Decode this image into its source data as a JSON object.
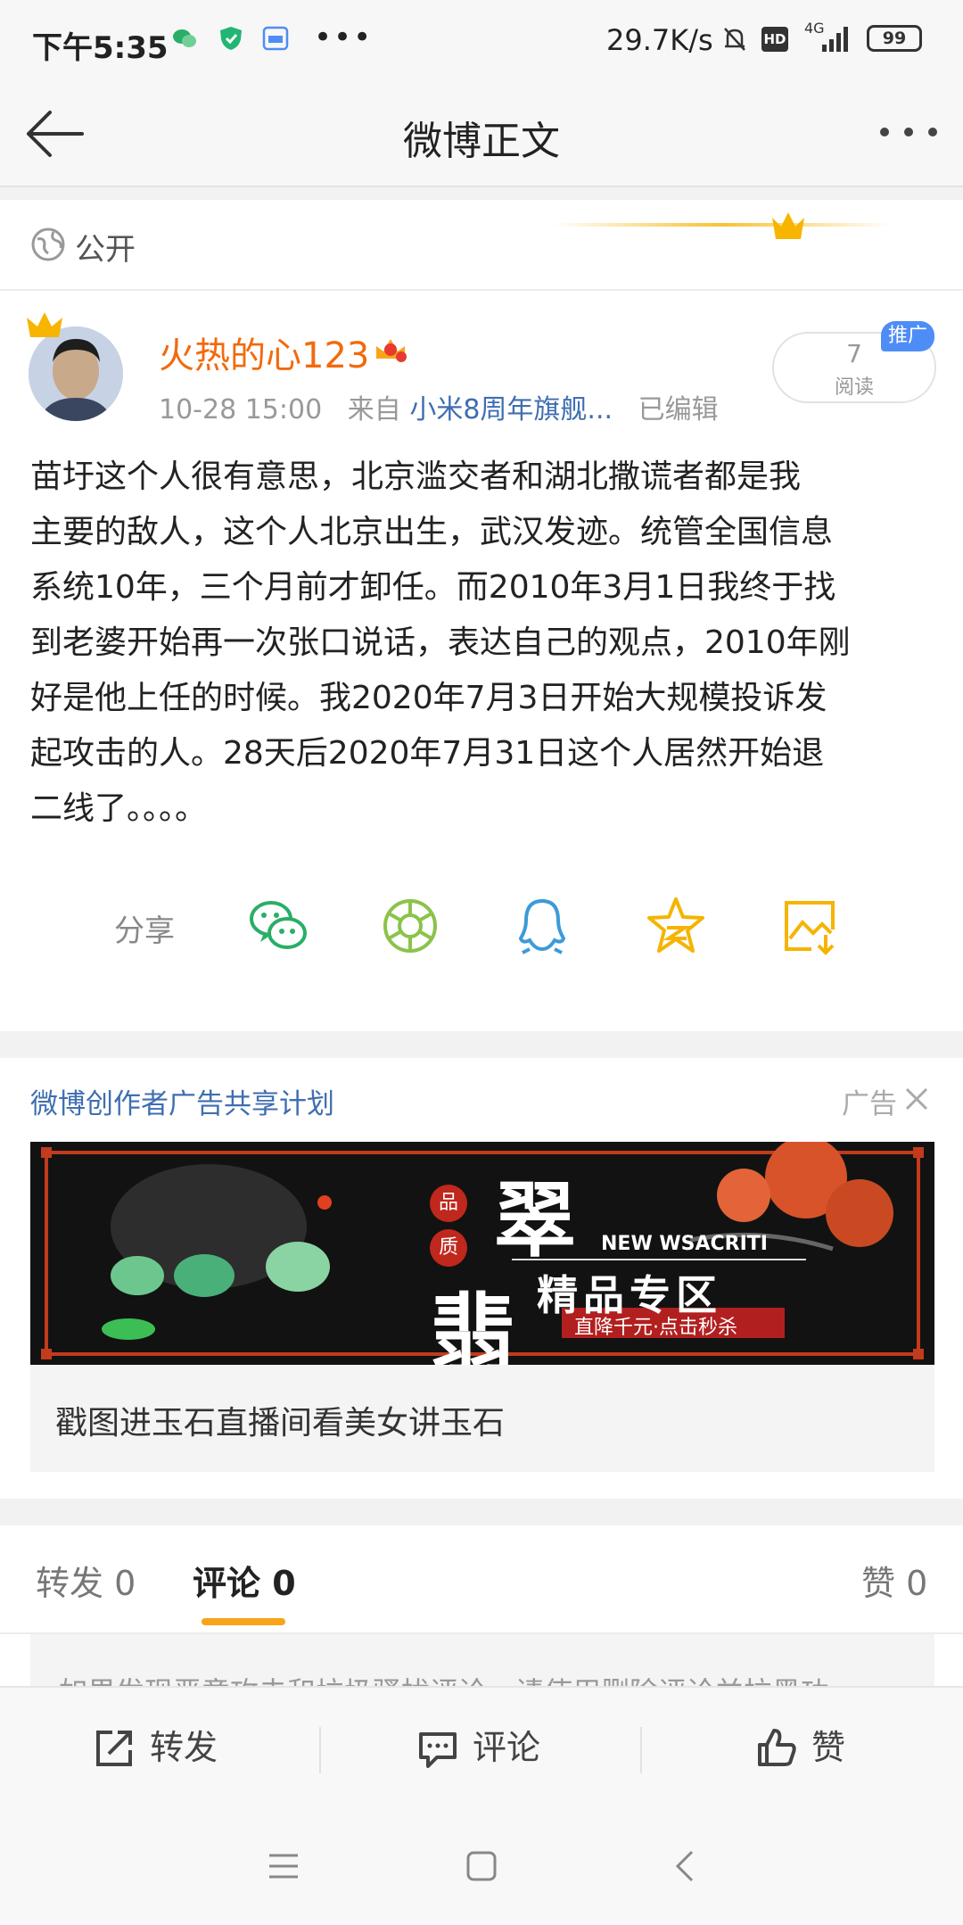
{
  "status_bar": {
    "time": "下午5:35",
    "more_icons": "•••",
    "net_speed": "29.7K/s",
    "hd": "HD",
    "network": "4G",
    "battery": "99"
  },
  "nav": {
    "title": "微博正文"
  },
  "visibility": {
    "label": "公开"
  },
  "post": {
    "username": "火热的心123",
    "time": "10-28 15:00",
    "from_prefix": "来自",
    "source": "小米8周年旗舰...",
    "edited": "已编辑",
    "read_count": "7",
    "read_label": "阅读",
    "promo_tag": "推广",
    "body": "苗圩这个人很有意思，北京滥交者和湖北撒谎者都是我\n主要的敌人，这个人北京出生，武汉发迹。统管全国信息\n系统10年，三个月前才卸任。而2010年3月1日我终于找\n到老婆开始再一次张口说话，表达自己的观点，2010年刚\n好是他上任的时候。我2020年7月3日开始大规模投诉发\n起攻击的人。28天后2020年7月31日这个人居然开始退\n二线了。。。。",
    "share_label": "分享"
  },
  "ad": {
    "title": "微博创作者广告共享计划",
    "tag": "广告",
    "banner_quality_1": "品",
    "banner_quality_2": "质",
    "banner_char_1": "翠",
    "banner_char_2": "翡",
    "banner_en": "NEW WSACRITI",
    "banner_cn": "精品专区",
    "banner_sub": "直降千元·点击秒杀",
    "caption": "戳图进玉石直播间看美女讲玉石"
  },
  "tabs": {
    "repost": "转发 0",
    "comment": "评论 0",
    "like": "赞 0"
  },
  "comment_hint": "如果发现恶意攻击和垃圾骚扰评论，请使用删除评论并拉黑功",
  "toolbar": {
    "repost": "转发",
    "comment": "评论",
    "like": "赞"
  },
  "colors": {
    "username": "#f26a0d",
    "link": "#3f6eb1",
    "accent_tab": "#f7a41a",
    "promo_tag": "#4e8df5",
    "wechat": "#2aae67",
    "moments": "#8bc34a",
    "qq": "#3d9ad9",
    "qzone": "#f5b400"
  }
}
